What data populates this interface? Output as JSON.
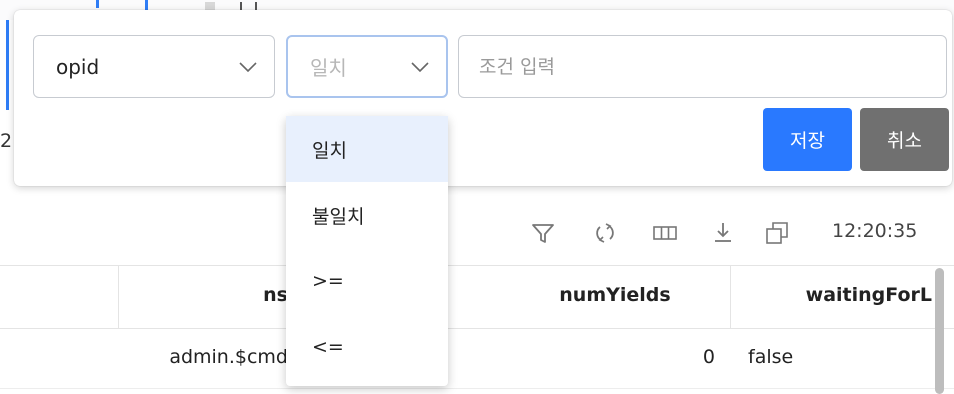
{
  "filter": {
    "field_select": {
      "value": "opid"
    },
    "operator_select": {
      "value": "일치"
    },
    "condition_input": {
      "placeholder": "조건 입력",
      "value": ""
    },
    "save_label": "저장",
    "cancel_label": "취소"
  },
  "operator_menu": {
    "items": [
      "일치",
      "불일치",
      ">=",
      "<="
    ],
    "selected": "일치"
  },
  "background": {
    "partial_char": "2"
  },
  "toolbar": {
    "icons": [
      "filter-icon",
      "refresh-icon",
      "columns-icon",
      "download-icon",
      "popout-icon"
    ],
    "time": "12:20:35"
  },
  "grid": {
    "columns": [
      "ns",
      "numYields",
      "waitingForL"
    ],
    "rows": [
      {
        "ns": "admin.$cmd",
        "numYields": "0",
        "waitingForL": "false"
      }
    ]
  },
  "colors": {
    "accent": "#2979ff",
    "cancel": "#707070",
    "menu_selected": "#e8f0fd"
  }
}
